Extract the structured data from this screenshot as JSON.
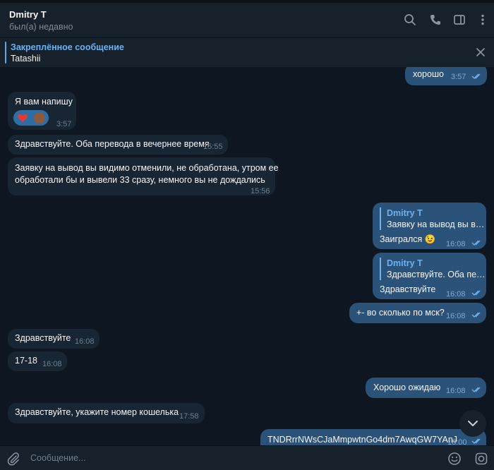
{
  "header": {
    "contact_name": "Dmitry T",
    "status": "был(а) недавно",
    "icons": [
      "search-icon",
      "phone-icon",
      "sidebar-icon",
      "more-icon"
    ]
  },
  "pinned": {
    "title": "Закреплённое сообщение",
    "text": "Tatashii"
  },
  "messages": [
    {
      "dir": "out",
      "text": "хорошо",
      "time": "3:57"
    },
    {
      "dir": "in",
      "text": "Я вам напишу",
      "time": "3:57",
      "reactions": [
        "heart",
        "avatar"
      ]
    },
    {
      "dir": "in",
      "text": "Здравствуйте. Оба перевода в вечернее время",
      "time": "15:55"
    },
    {
      "dir": "in",
      "text_lines": [
        "Заявку на вывод вы видимо отменили, не обработана, утром ее",
        "обработали бы и вывели 33 сразу, немного вы не дождались"
      ],
      "time": "15:56"
    },
    {
      "dir": "out",
      "reply_name": "Dmitry T",
      "reply_text": "Заявку на вывод вы в…",
      "text": "Заигрался 😉",
      "time": "16:08"
    },
    {
      "dir": "out",
      "reply_name": "Dmitry T",
      "reply_text": "Здравствуйте. Оба пе…",
      "text": "Здравствуйте",
      "time": "16:08"
    },
    {
      "dir": "out",
      "text": "+- во сколько по мск?",
      "time": "16:08"
    },
    {
      "dir": "in",
      "text": "Здравствуйте",
      "time": "16:08"
    },
    {
      "dir": "in",
      "text": "17-18",
      "time": "16:08"
    },
    {
      "dir": "out",
      "text": "Хорошо ожидаю",
      "time": "16:08"
    },
    {
      "dir": "in",
      "text": "Здравствуйте, укажите номер кошелька",
      "time": "17:58"
    },
    {
      "dir": "out",
      "text": "TNDRrrNWsCJaMmpwtnGo4dm7AwqGW7YAnJ",
      "time": "18:00"
    }
  ],
  "composer": {
    "placeholder": "Сообщение..."
  },
  "colors": {
    "background": "#0e1621",
    "panel": "#17212b",
    "incoming_bubble": "#182533",
    "outgoing_bubble": "#2b5278",
    "accent": "#6ab2f2"
  }
}
